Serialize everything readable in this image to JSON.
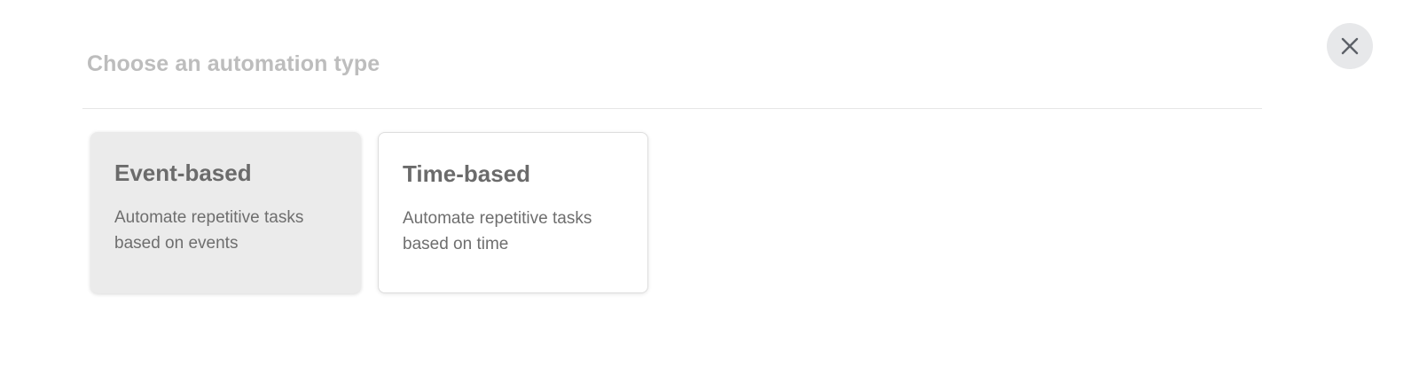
{
  "dialog": {
    "title": "Choose an automation type",
    "close_icon": "close-icon"
  },
  "options": [
    {
      "title": "Event-based",
      "description": "Automate repetitive tasks based on events",
      "selected": true
    },
    {
      "title": "Time-based",
      "description": "Automate repetitive tasks based on time",
      "selected": false
    }
  ],
  "colors": {
    "title": "#bdbdbd",
    "selected_card_bg": "#ebebeb",
    "card_border": "#dedede",
    "close_button_bg": "#e7e8ea",
    "card_text": "#6b6b6b"
  }
}
